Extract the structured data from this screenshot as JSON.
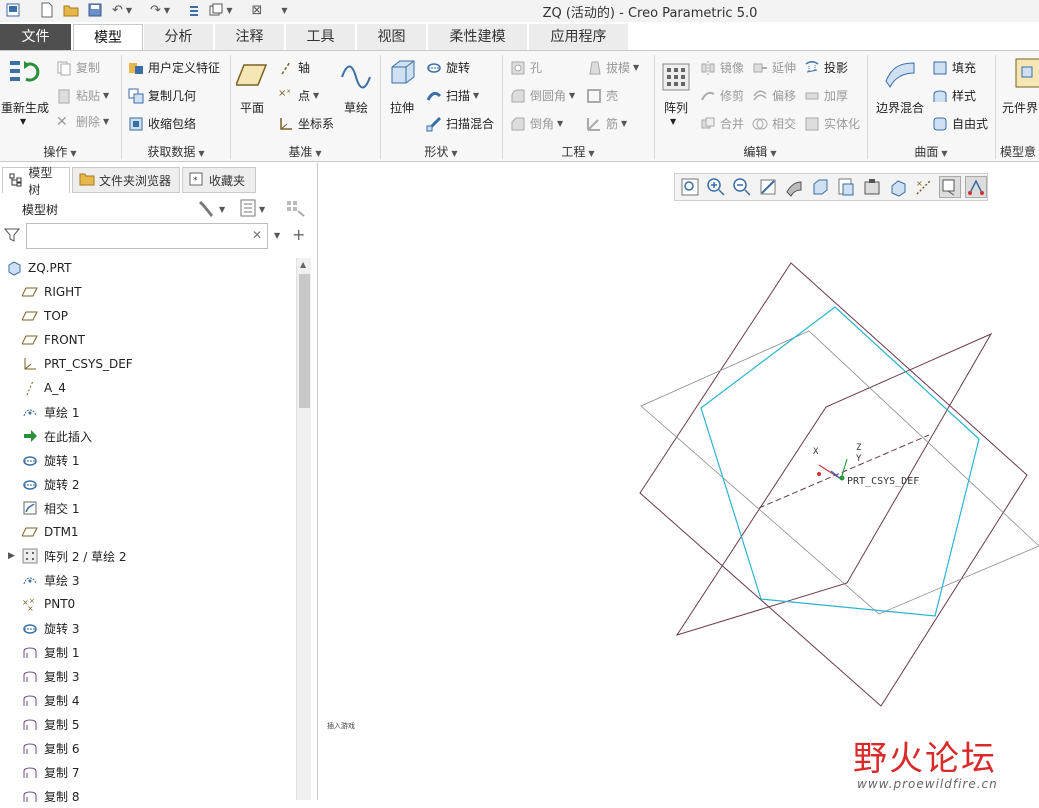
{
  "window": {
    "title": "ZQ (活动的) - Creo Parametric 5.0"
  },
  "tabs": [
    {
      "label": "文件"
    },
    {
      "label": "模型"
    },
    {
      "label": "分析"
    },
    {
      "label": "注释"
    },
    {
      "label": "工具"
    },
    {
      "label": "视图"
    },
    {
      "label": "柔性建模"
    },
    {
      "label": "应用程序"
    }
  ],
  "ribbon": {
    "operations": {
      "label": "操作",
      "regenerate": "重新生成",
      "copy": "复制",
      "paste": "粘贴",
      "delete": "删除"
    },
    "get_data": {
      "label": "获取数据",
      "udf": "用户定义特征",
      "copy_geom": "复制几何",
      "shrinkwrap": "收缩包络"
    },
    "datum": {
      "label": "基准",
      "plane": "平面",
      "axis": "轴",
      "point": "点",
      "csys": "坐标系",
      "sketch": "草绘"
    },
    "shapes": {
      "label": "形状",
      "extrude": "拉伸",
      "revolve": "旋转",
      "sweep": "扫描",
      "swept_blend": "扫描混合"
    },
    "engineering": {
      "label": "工程",
      "hole": "孔",
      "round": "倒圆角",
      "chamfer": "倒角",
      "draft": "拔模",
      "shell": "壳",
      "rib": "筋"
    },
    "editing": {
      "label": "编辑",
      "pattern": "阵列",
      "mirror": "镜像",
      "trim": "修剪",
      "merge": "合并",
      "extend": "延伸",
      "offset": "偏移",
      "intersect": "相交",
      "project": "投影",
      "thicken": "加厚",
      "solidify": "实体化"
    },
    "surfaces": {
      "label": "曲面",
      "boundary_blend": "边界混合",
      "fill": "填充",
      "style": "样式",
      "freestyle": "自由式"
    },
    "model_intent": {
      "label": "模型意",
      "component": "元件界"
    }
  },
  "panel": {
    "tabs": [
      {
        "label": "模型树"
      },
      {
        "label": "文件夹浏览器"
      },
      {
        "label": "收藏夹"
      }
    ],
    "header_title": "模型树",
    "search_placeholder": ""
  },
  "tree": [
    {
      "label": "ZQ.PRT",
      "icon": "part-icon"
    },
    {
      "label": "RIGHT",
      "icon": "datum-plane-icon"
    },
    {
      "label": "TOP",
      "icon": "datum-plane-icon"
    },
    {
      "label": "FRONT",
      "icon": "datum-plane-icon"
    },
    {
      "label": "PRT_CSYS_DEF",
      "icon": "csys-icon"
    },
    {
      "label": "A_4",
      "icon": "axis-icon"
    },
    {
      "label": "草绘 1",
      "icon": "sketch-icon"
    },
    {
      "label": "在此插入",
      "icon": "insert-arrow-icon"
    },
    {
      "label": "旋转 1",
      "icon": "revolve-icon"
    },
    {
      "label": "旋转 2",
      "icon": "revolve-icon"
    },
    {
      "label": "相交 1",
      "icon": "intersect-icon"
    },
    {
      "label": "DTM1",
      "icon": "datum-plane-icon"
    },
    {
      "label": "阵列 2 / 草绘 2",
      "icon": "pattern-icon"
    },
    {
      "label": "草绘 3",
      "icon": "sketch-icon"
    },
    {
      "label": "PNT0",
      "icon": "datum-point-icon"
    },
    {
      "label": "旋转 3",
      "icon": "revolve-icon"
    },
    {
      "label": "复制 1",
      "icon": "copy-surface-icon"
    },
    {
      "label": "复制 3",
      "icon": "copy-surface-icon"
    },
    {
      "label": "复制 4",
      "icon": "copy-surface-icon"
    },
    {
      "label": "复制 5",
      "icon": "copy-surface-icon"
    },
    {
      "label": "复制 6",
      "icon": "copy-surface-icon"
    },
    {
      "label": "复制 7",
      "icon": "copy-surface-icon"
    },
    {
      "label": "复制 8",
      "icon": "copy-surface-icon"
    }
  ],
  "viewport": {
    "csys_label": "PRT_CSYS_DEF",
    "axis_x": "X",
    "axis_y": "Y",
    "axis_z": "Z",
    "status_note": "插入游戏",
    "watermark_title": "野火论坛",
    "watermark_url": "www.proewildfire.cn"
  },
  "colors": {
    "file_tab": "#4f4f4f",
    "plane": "#6b3a4f",
    "pentagon": "#2bb3cf",
    "datum_gray": "#8a8a8a"
  }
}
